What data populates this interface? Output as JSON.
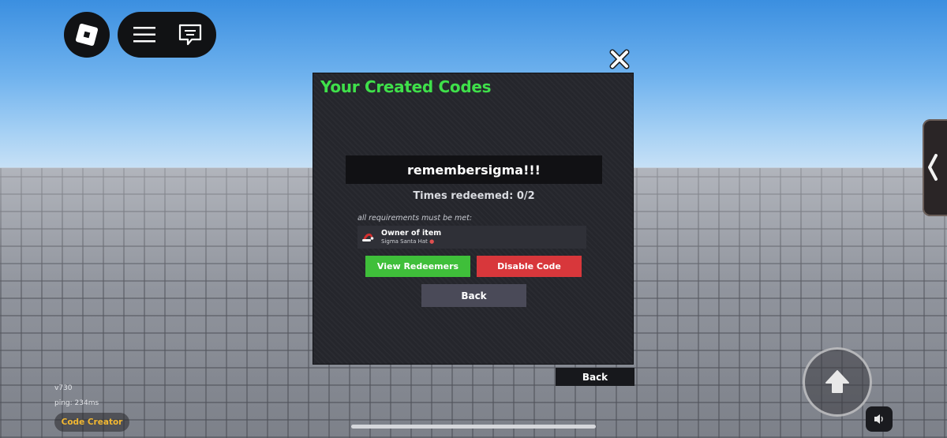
{
  "panel": {
    "title": "Your Created Codes",
    "code": "remembersigma!!!",
    "times_redeemed": "Times redeemed: 0/2",
    "requirements_note": "all requirements must be met:",
    "requirement": {
      "title": "Owner of item",
      "subtitle": "Sigma Santa Hat",
      "icon": "santa-hat-icon"
    },
    "buttons": {
      "view_redeemers": "View Redeemers",
      "disable_code": "Disable Code",
      "back": "Back"
    }
  },
  "outer_back": "Back",
  "hud": {
    "version": "v730",
    "ping": "ping: 234ms",
    "code_creator": "Code Creator"
  },
  "icons": {
    "roblox_menu": "roblox-logo-icon",
    "menu": "hamburger-icon",
    "chat": "chat-icon",
    "close": "close-icon",
    "side_tab": "chevron-left-icon",
    "jump": "jump-arrow-icon",
    "volume": "speaker-icon"
  },
  "colors": {
    "title_green": "#3fe04a",
    "button_green": "#3fbf3a",
    "button_red": "#d8373b",
    "code_creator_gold": "#f2b731"
  }
}
